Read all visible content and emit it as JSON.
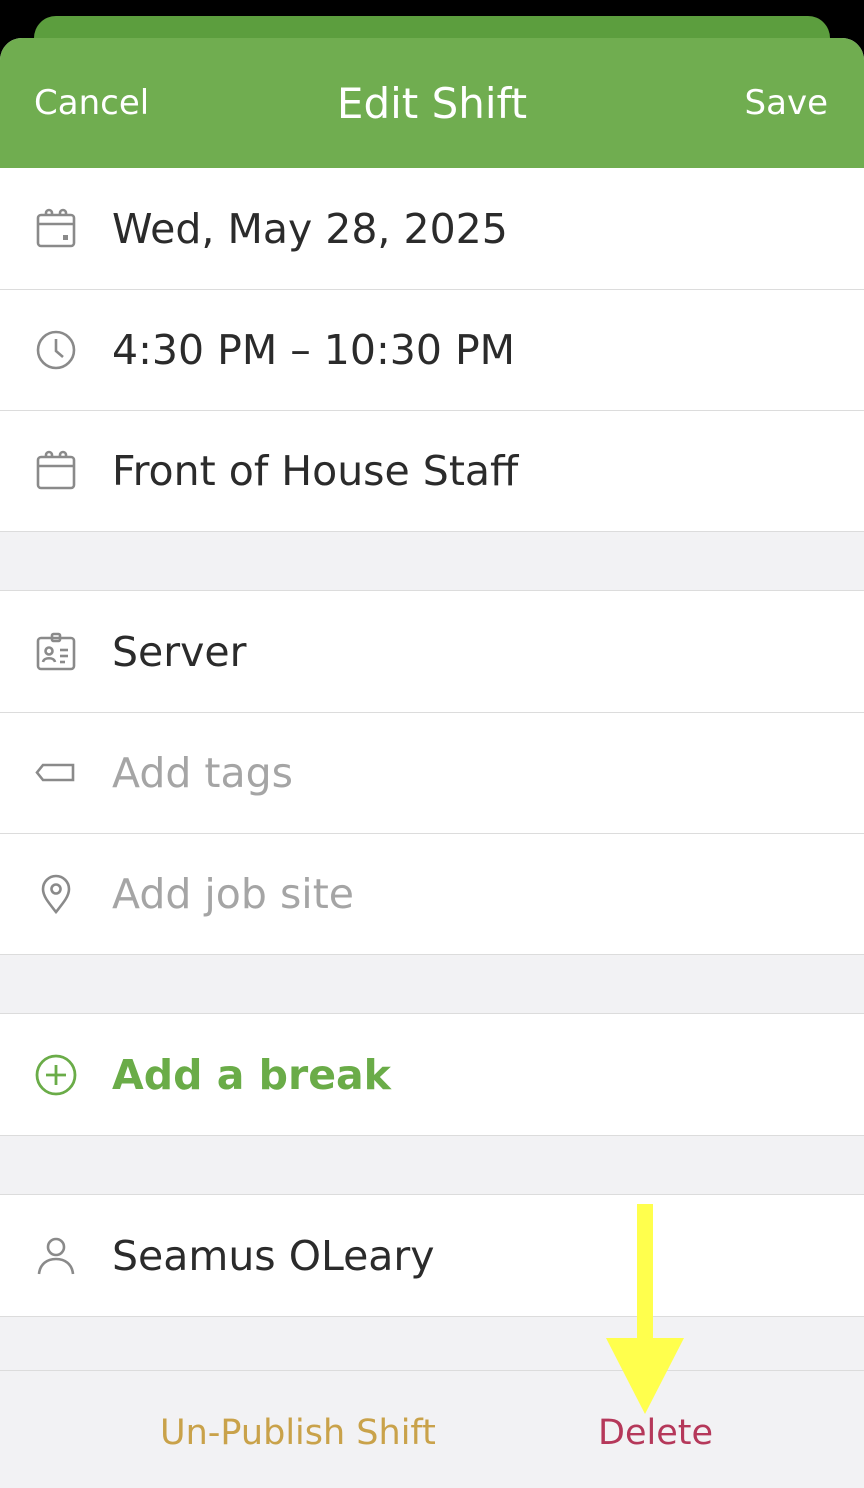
{
  "nav": {
    "cancel_label": "Cancel",
    "title": "Edit Shift",
    "save_label": "Save"
  },
  "shift": {
    "date": "Wed, May 28, 2025",
    "time": "4:30 PM – 10:30 PM",
    "schedule": "Front of House Staff"
  },
  "details": {
    "position": "Server",
    "tags_placeholder": "Add tags",
    "job_site_placeholder": "Add job site"
  },
  "breaks": {
    "add_label": "Add a break"
  },
  "assignee": {
    "name": "Seamus OLeary"
  },
  "footer": {
    "unpublish_label": "Un-Publish Shift",
    "delete_label": "Delete"
  },
  "colors": {
    "brand_green": "#70ad50",
    "accent_green": "#6aac48",
    "unpublish_gold": "#c9a24a",
    "delete_red": "#b5385a",
    "annotation_arrow": "#ffff4d"
  },
  "icons": {
    "date": "calendar-icon",
    "time": "clock-icon",
    "schedule": "calendar-icon",
    "position": "id-badge-icon",
    "tags": "tag-icon",
    "job_site": "location-pin-icon",
    "add_break": "plus-circle-icon",
    "assignee": "person-icon",
    "annotation": "arrow-down-icon"
  }
}
